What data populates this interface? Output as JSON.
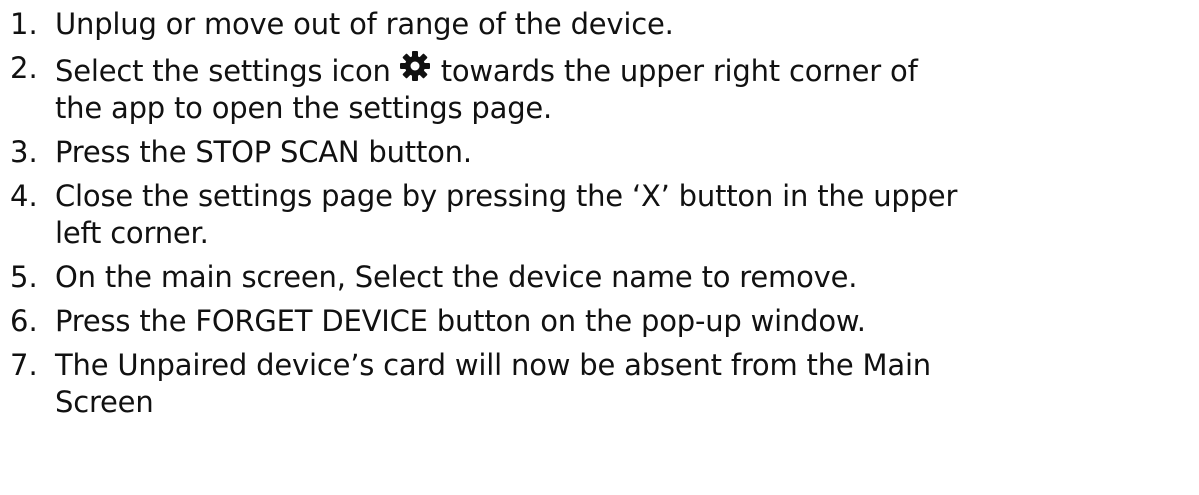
{
  "steps": [
    {
      "number": "1.",
      "text": "Unplug or move out of range of the device."
    },
    {
      "number": "2.",
      "text_before_icon": "Select the settings icon",
      "icon": "gear-icon",
      "text_after_icon": "towards the upper right corner of",
      "text_line2": "the app to open the settings page."
    },
    {
      "number": "3.",
      "text": "Press the STOP SCAN button."
    },
    {
      "number": "4.",
      "text": "Close the settings page by pressing the ‘X’ button in the upper",
      "text_line2": "left corner."
    },
    {
      "number": "5.",
      "text": "On the main screen, Select the device name to remove."
    },
    {
      "number": "6.",
      "text": "Press the FORGET DEVICE button on the pop-up window."
    },
    {
      "number": "7.",
      "text": "The Unpaired device’s card will now be absent from the Main",
      "text_line2": "Screen"
    }
  ]
}
